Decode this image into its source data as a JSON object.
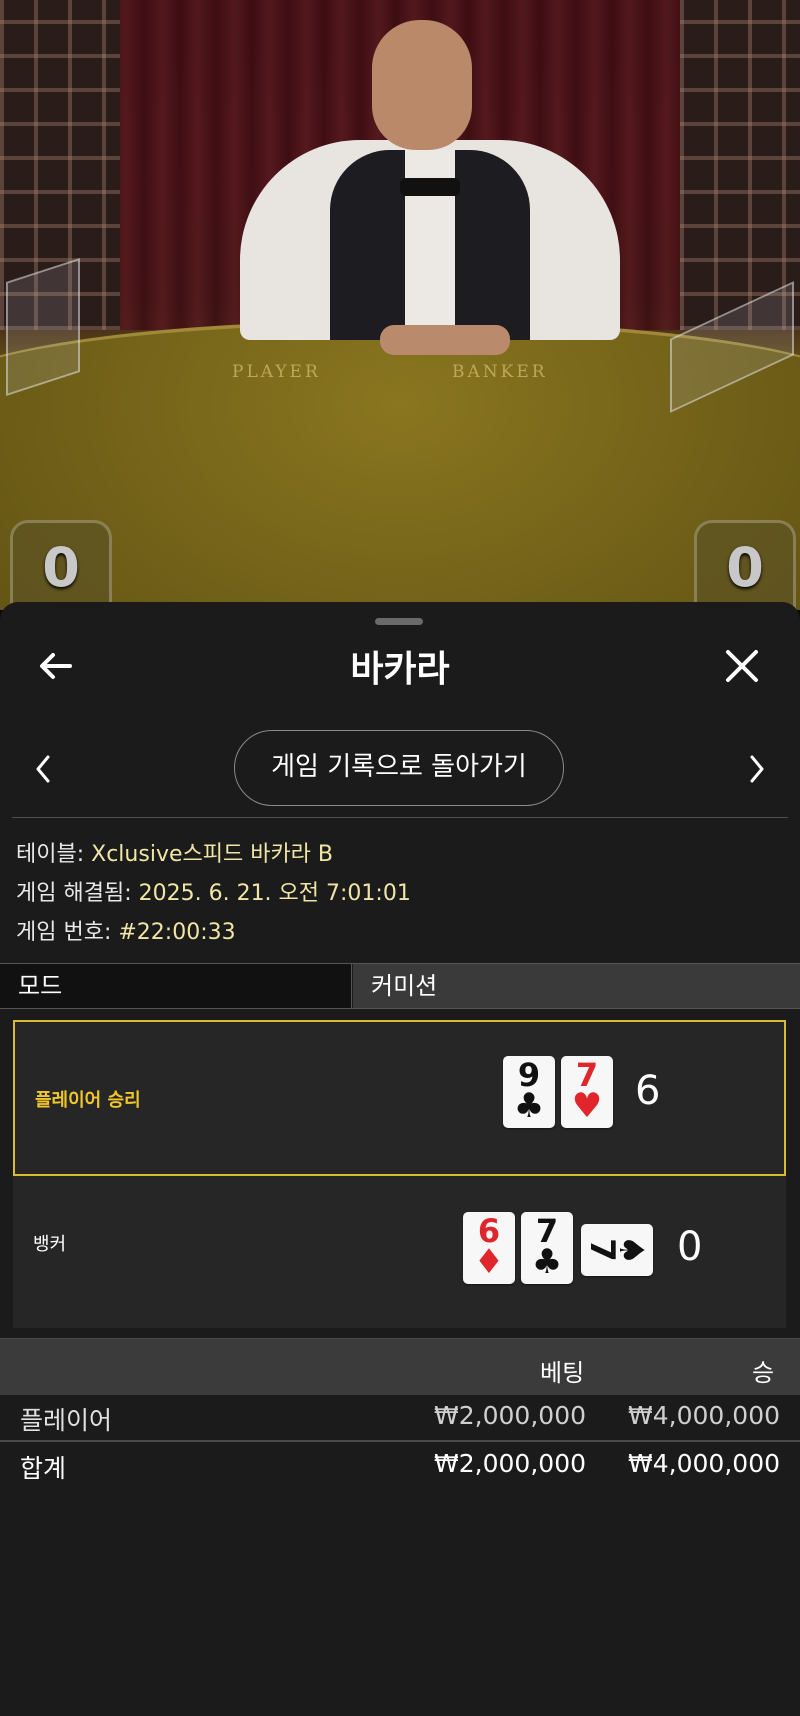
{
  "video": {
    "felt_player": "PLAYER",
    "felt_banker": "BANKER",
    "score_left": "0",
    "score_right": "0"
  },
  "header": {
    "title": "바카라",
    "back_icon": "arrow-left-icon",
    "close_icon": "close-icon"
  },
  "nav": {
    "back_to_history": "게임 기록으로 돌아가기",
    "prev_icon": "chevron-left-icon",
    "next_icon": "chevron-right-icon"
  },
  "info": {
    "table_label": "테이블: ",
    "table_value": "Xclusive스피드 바카라 B",
    "resolved_label": "게임 해결됨: ",
    "resolved_value": "2025. 6. 21. 오전 7:01:01",
    "number_label": "게임 번호: ",
    "number_value": "#22:00:33"
  },
  "tabs": {
    "mode": "모드",
    "commission": "커미션"
  },
  "result": {
    "player": {
      "label": "플레이어 승리",
      "cards": [
        {
          "rank": "9",
          "suit": "♣",
          "color": "black"
        },
        {
          "rank": "7",
          "suit": "♥",
          "color": "red"
        }
      ],
      "score": "6"
    },
    "banker": {
      "label": "뱅커",
      "cards": [
        {
          "rank": "6",
          "suit": "♦",
          "color": "red"
        },
        {
          "rank": "7",
          "suit": "♣",
          "color": "black"
        },
        {
          "rank": "7",
          "suit": "♠",
          "color": "black",
          "sideways": true
        }
      ],
      "score": "0"
    },
    "highlight_color": "#d9bb2f"
  },
  "bets": {
    "col_bet": "베팅",
    "col_win": "승",
    "rows": [
      {
        "name": "플레이어",
        "bet": "₩2,000,000",
        "win": "₩4,000,000"
      }
    ],
    "total": {
      "name": "합계",
      "bet": "₩2,000,000",
      "win": "₩4,000,000"
    }
  }
}
